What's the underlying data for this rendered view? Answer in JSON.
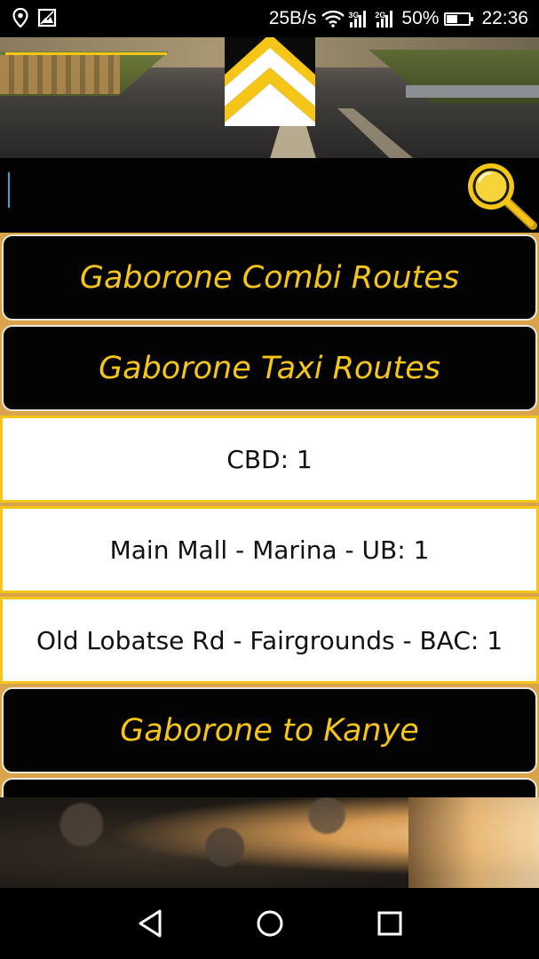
{
  "status_bar": {
    "speed": "25B/s",
    "net1": "3G",
    "net2": "2G",
    "battery": "50%",
    "battery_level": 0.5,
    "time": "22:36",
    "icons": [
      "location-icon",
      "image-icon",
      "wifi-icon",
      "signal-3g-icon",
      "signal-2g-icon",
      "battery-icon"
    ]
  },
  "search": {
    "value": "",
    "placeholder": ""
  },
  "list": {
    "categories": [
      "Gaborone Combi Routes",
      "Gaborone Taxi Routes",
      "Gaborone to Kanye"
    ],
    "routes": [
      "CBD: 1",
      "Main Mall - Marina - UB: 1",
      "Old Lobatse Rd - Fairgrounds - BAC: 1"
    ]
  },
  "colors": {
    "accent": "#f5c518",
    "card_bg": "#030303",
    "route_bg": "#ffffff"
  },
  "nav": {
    "icons": [
      "back-icon",
      "home-icon",
      "recents-icon"
    ]
  }
}
